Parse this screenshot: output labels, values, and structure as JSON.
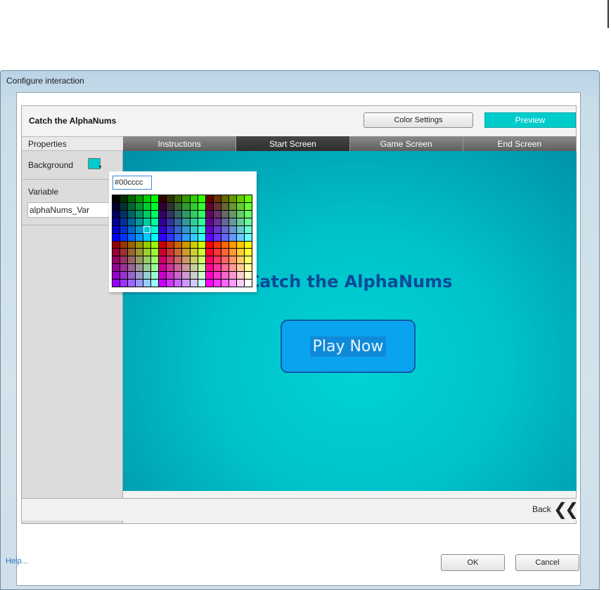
{
  "window": {
    "title": "Configure interaction"
  },
  "header": {
    "title": "Catch the AlphaNums",
    "color_settings_label": "Color Settings",
    "preview_label": "Preview",
    "preview_color": "#00cccc"
  },
  "properties": {
    "heading": "Properties",
    "background_label": "Background",
    "background_color": "#00cccc",
    "variable_label": "Variable",
    "variable_value": "alphaNums_Var"
  },
  "tabs": [
    {
      "label": "Instructions",
      "active": false
    },
    {
      "label": "Start Screen",
      "active": true
    },
    {
      "label": "Game Screen",
      "active": false
    },
    {
      "label": "End Screen",
      "active": false
    }
  ],
  "stage": {
    "title": "Catch the AlphaNums",
    "play_label": "Play Now"
  },
  "color_picker": {
    "hex_value": "#00cccc",
    "selected_color": "#00cccc"
  },
  "footer": {
    "back_label": "Back",
    "help_label": "Help...",
    "ok_label": "OK",
    "cancel_label": "Cancel"
  },
  "icons": {
    "back": "double-chevron-left-icon",
    "dropdown": "chevron-down-icon"
  }
}
